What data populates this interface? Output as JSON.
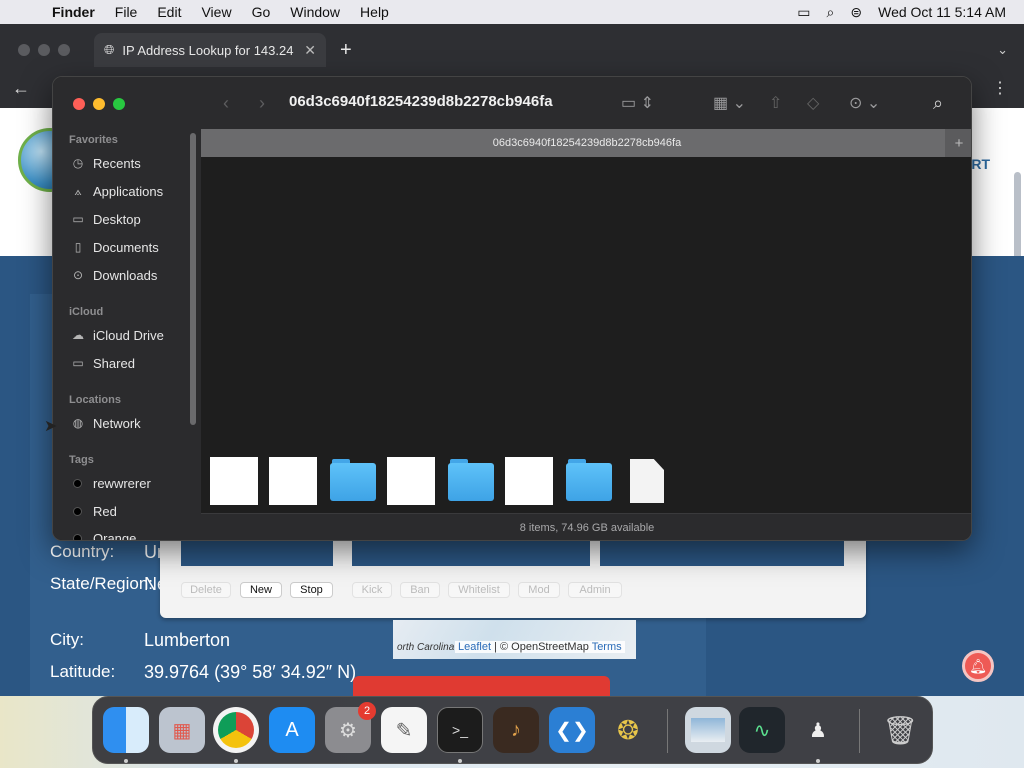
{
  "menubar": {
    "app": "Finder",
    "items": [
      "File",
      "Edit",
      "View",
      "Go",
      "Window",
      "Help"
    ],
    "datetime": "Wed Oct 11  5:14 AM"
  },
  "browser": {
    "tab_title": "IP Address Lookup for 143.24",
    "tab_close": "✕",
    "new_tab": "+"
  },
  "webpage": {
    "nav_fragment": "RT",
    "info": [
      {
        "label": "Country:",
        "value": "Ur"
      },
      {
        "label": "State/Region:",
        "value": "Ne"
      },
      {
        "label": "City:",
        "value": "Lumberton"
      },
      {
        "label": "Latitude:",
        "value": "39.9764  (39° 58′ 34.92″ N)"
      }
    ],
    "buttons": [
      "Delete",
      "New",
      "Stop",
      "Kick",
      "Ban",
      "Whitelist",
      "Mod",
      "Admin"
    ],
    "map": {
      "region": "orth Carolina",
      "attribution_link": "Leaflet",
      "attribution_text": " | © OpenStreetMap ",
      "terms": "Terms"
    }
  },
  "finder": {
    "title": "06d3c6940f18254239d8b2278cb946fa",
    "path_title": "06d3c6940f18254239d8b2278cb946fa",
    "path_plus": "+",
    "status": "8 items, 74.96 GB available",
    "sidebar": {
      "favorites_header": "Favorites",
      "favorites": [
        "Recents",
        "Applications",
        "Desktop",
        "Documents",
        "Downloads"
      ],
      "icloud_header": "iCloud",
      "icloud": [
        "iCloud Drive",
        "Shared"
      ],
      "locations_header": "Locations",
      "locations": [
        "Network"
      ],
      "tags_header": "Tags",
      "tags": [
        "rewwrerer",
        "Red",
        "Orange"
      ]
    },
    "items": [
      "white-file",
      "white-file",
      "folder",
      "white-file",
      "folder",
      "white-file",
      "folder",
      "document"
    ]
  },
  "dock": {
    "apps": [
      "Finder",
      "Launchpad",
      "Chrome",
      "App Store",
      "System Settings",
      "TextEdit",
      "Terminal",
      "Instruments",
      "VS Code",
      "Cyberduck",
      "Preview",
      "Activity Monitor",
      "Figure"
    ],
    "settings_badge": "2",
    "trash": "Trash"
  },
  "colors": {
    "finder_bg": "#1e1e1e",
    "sidebar_bg": "#2b2b2d",
    "folder_blue": "#4fb4f2",
    "page_blue": "#2b5683",
    "red_close": "#fe5f57",
    "yellow_min": "#febc2e",
    "green_max": "#28c840"
  }
}
